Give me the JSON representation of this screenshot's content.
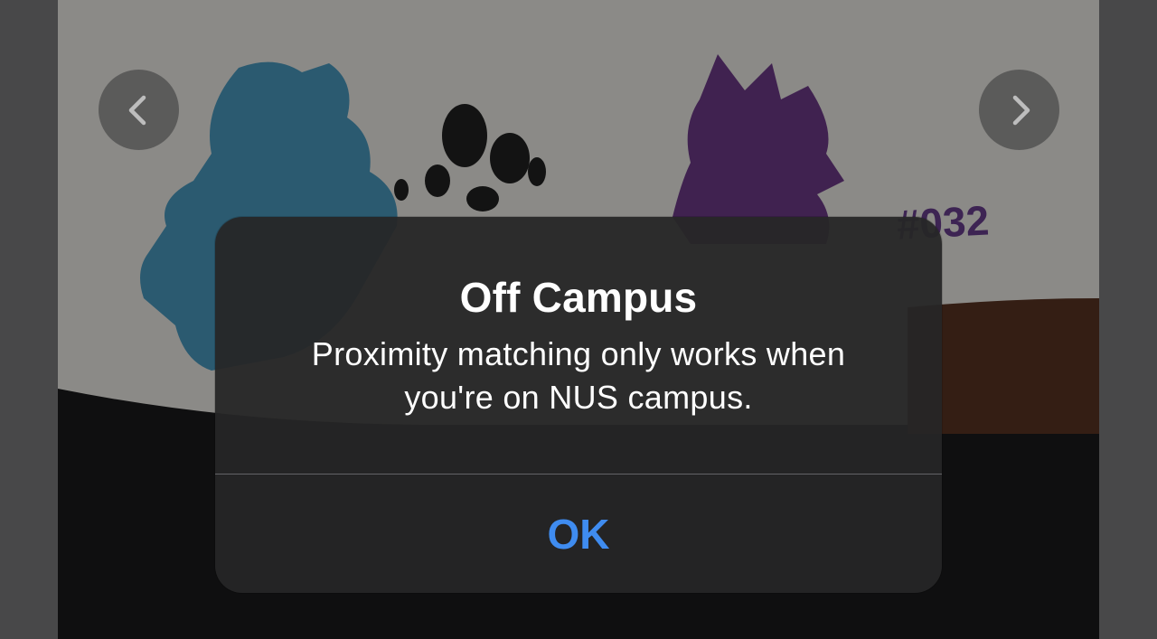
{
  "alert": {
    "title": "Off Campus",
    "message": "Proximity matching only works when you're on NUS campus.",
    "ok_label": "OK"
  },
  "navigation": {
    "previous_icon": "chevron-left-icon",
    "next_icon": "chevron-right-icon"
  },
  "photo": {
    "stamp_text": "#032"
  },
  "colors": {
    "alert_background": "#262626",
    "ok_button_text": "#3f8cf0",
    "title_text": "#ffffff"
  }
}
